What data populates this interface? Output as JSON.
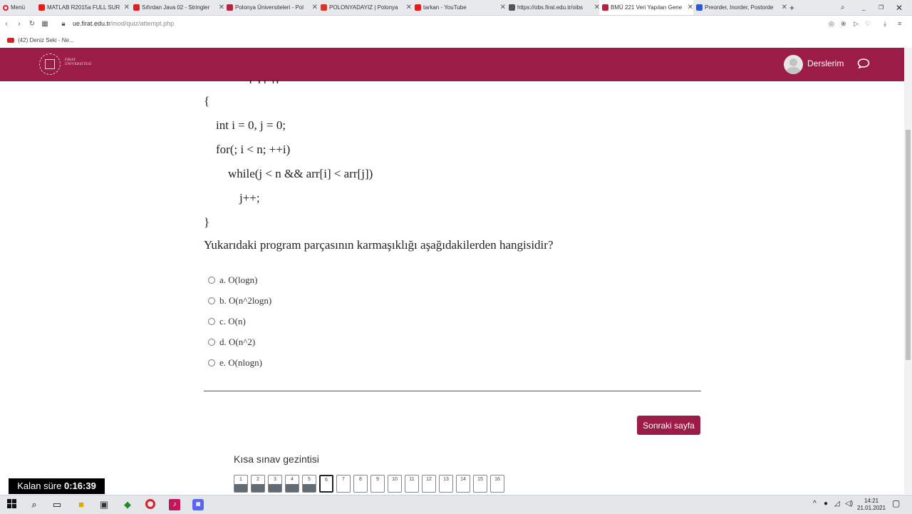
{
  "browser": {
    "menu_label": "Menü",
    "tabs": [
      {
        "title": "MATLAB R2015a FULL SUR",
        "icon": "youtube-icon",
        "color": "#e02020"
      },
      {
        "title": "Sıfırdan Java 02 - Stringler",
        "icon": "youtube-icon",
        "color": "#e02020"
      },
      {
        "title": "Polonya Üniversiteleri - Pol",
        "icon": "site-icon",
        "color": "#b5243c"
      },
      {
        "title": "POLONYADAYIZ | Polonya",
        "icon": "site-icon",
        "color": "#d13a2a"
      },
      {
        "title": "tarkan - YouTube",
        "icon": "youtube-icon",
        "color": "#e02020"
      },
      {
        "title": "https://obs.firat.edu.tr/oibs",
        "icon": "page-icon",
        "color": "#555555"
      },
      {
        "title": "BMÜ 221 Veri Yapıları Gene",
        "icon": "moodle-icon",
        "color": "#b5243c"
      },
      {
        "title": "Preorder, Inorder, Postorde",
        "icon": "site-icon",
        "color": "#2a5bd7"
      }
    ],
    "url_domain": "ue.firat.edu.tr",
    "url_path": "/mod/quiz/attempt.php",
    "bookmark": "(42) Deniz Seki - Ne..."
  },
  "header": {
    "logo_line1": "FIRAT",
    "logo_line2": "ÜNİVERSİTESİ",
    "courses_label": "Derslerim",
    "brand_color": "#9b1c46"
  },
  "quiz": {
    "code_lines": [
      "{",
      "int i = 0, j = 0;",
      "for(; i < n; ++i)",
      "while(j < n && arr[i] < arr[j])",
      "j++;",
      "}"
    ],
    "question": "Yukarıdaki program parçasının karmaşıklığı aşağıdakilerden hangisidir?",
    "options": [
      {
        "label": "a. O(logn)"
      },
      {
        "label": "b. O(n^2logn)"
      },
      {
        "label": "c. O(n)"
      },
      {
        "label": "d. O(n^2)"
      },
      {
        "label": "e. O(nlogn)"
      }
    ],
    "next_label": "Sonraki sayfa",
    "nav_title": "Kısa sınav gezintisi",
    "nav_items": [
      "1",
      "2",
      "3",
      "4",
      "5",
      "6",
      "7",
      "8",
      "9",
      "10",
      "11",
      "12",
      "13",
      "14",
      "15",
      "16"
    ],
    "answered_count": 5,
    "current_question": 6
  },
  "timer": {
    "label": "Kalan süre",
    "value": "0:16:39"
  },
  "taskbar": {
    "time": "14:21",
    "date": "21.01.2021"
  }
}
